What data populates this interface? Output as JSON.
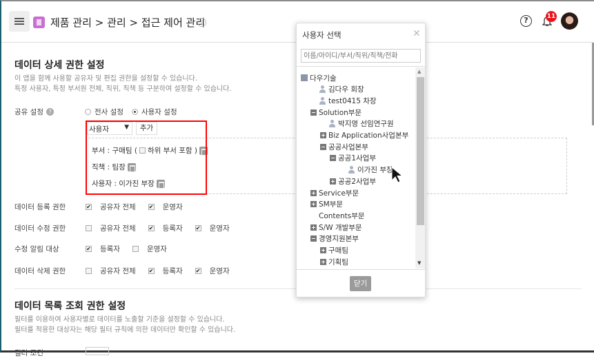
{
  "header": {
    "breadcrumb": "제품 관리 > 관리 > 접근 제어 관리",
    "notification_count": "11"
  },
  "section1": {
    "title": "데이터 상세 권한 설정",
    "desc1": "이 앱을 함께 사용할 공유자 및 편집 권한을 설정할 수 있습니다.",
    "desc2": "특정 사용자, 특정 부서원 전체, 직위, 직책 등 구분하여 설정할 수 있습니다.",
    "share_label": "공유 설정",
    "radio_all": "전사 설정",
    "radio_user": "사용자 설정",
    "radio_selected": "user",
    "select_value": "사용자",
    "add_label": "추가",
    "entries": {
      "dept": "부서 : 구매팀 (",
      "dept_sub": "하위 부서 포함 )",
      "duty": "직책 : 팀장",
      "user": "사용자 : 이가진 부장"
    },
    "perm_rows": [
      {
        "label": "데이터 등록 권한",
        "opts": [
          {
            "t": "공유자 전체",
            "c": true
          },
          {
            "t": "운영자",
            "c": true
          }
        ]
      },
      {
        "label": "데이터 수정 권한",
        "opts": [
          {
            "t": "공유자 전체",
            "c": false
          },
          {
            "t": "등록자",
            "c": true
          },
          {
            "t": "운영자",
            "c": true
          }
        ]
      },
      {
        "label": "수정 알림 대상",
        "opts": [
          {
            "t": "등록자",
            "c": true
          },
          {
            "t": "운영자",
            "c": false
          }
        ]
      },
      {
        "label": "데이터 삭제 권한",
        "opts": [
          {
            "t": "공유자 전체",
            "c": false
          },
          {
            "t": "등록자",
            "c": true
          },
          {
            "t": "운영자",
            "c": true
          }
        ]
      }
    ]
  },
  "section2": {
    "title": "데이터 목록 조회 권한 설정",
    "desc1": "필터를 이용하여 사용자별로 데이터를 노출할 기준을 설정할 수 있습니다.",
    "desc2": "필터를 적용한 대상자는 해당 필터 규칙에 의한 데이터만 확인할 수 있습니다.",
    "filter_label": "필터 조건"
  },
  "modal": {
    "title": "사용자 선택",
    "search_placeholder": "이름/아이디/부서/직위/직책/전화",
    "close_label": "닫기",
    "tree": [
      {
        "t": "다우기술",
        "l": 0,
        "k": "org"
      },
      {
        "t": "김다우 회장",
        "l": 1,
        "k": "person"
      },
      {
        "t": "test0415 차장",
        "l": 1,
        "k": "person"
      },
      {
        "t": "Solution부문",
        "l": 1,
        "k": "minus"
      },
      {
        "t": "박지영 선임연구원",
        "l": 2,
        "k": "person"
      },
      {
        "t": "Biz Application사업본부",
        "l": 2,
        "k": "plus"
      },
      {
        "t": "공공사업본부",
        "l": 2,
        "k": "minus"
      },
      {
        "t": "공공1사업부",
        "l": 3,
        "k": "minus"
      },
      {
        "t": "이가진 부장",
        "l": 4,
        "k": "person"
      },
      {
        "t": "공공2사업부",
        "l": 3,
        "k": "plus"
      },
      {
        "t": "Service부문",
        "l": 1,
        "k": "plus"
      },
      {
        "t": "SM부문",
        "l": 1,
        "k": "plus"
      },
      {
        "t": "Contents부문",
        "l": 1,
        "k": "none"
      },
      {
        "t": "S/W 개발부문",
        "l": 1,
        "k": "plus"
      },
      {
        "t": "경영지원본부",
        "l": 1,
        "k": "minus"
      },
      {
        "t": "구매팀",
        "l": 2,
        "k": "plus"
      },
      {
        "t": "기획팀",
        "l": 2,
        "k": "plus"
      }
    ]
  }
}
